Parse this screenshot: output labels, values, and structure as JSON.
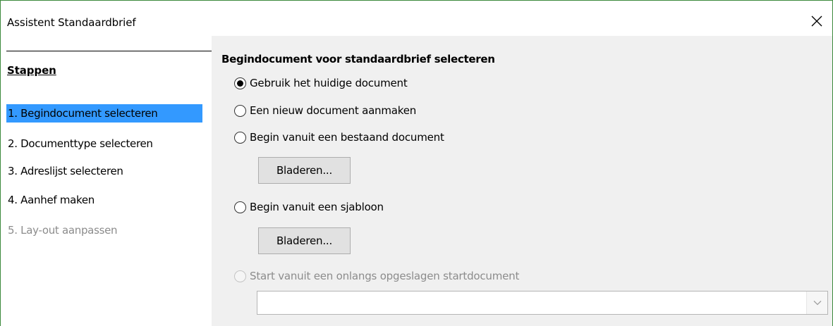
{
  "window": {
    "title": "Assistent Standaardbrief"
  },
  "sidebar": {
    "heading": "Stappen",
    "steps": [
      {
        "label": "1. Begindocument selecteren",
        "state": "active"
      },
      {
        "label": "2. Documenttype selecteren",
        "state": "enabled"
      },
      {
        "label": "3. Adreslijst selecteren",
        "state": "enabled"
      },
      {
        "label": "4. Aanhef maken",
        "state": "enabled"
      },
      {
        "label": "5. Lay-out aanpassen",
        "state": "disabled"
      }
    ]
  },
  "main": {
    "title": "Begindocument voor standaardbrief selecteren",
    "options": {
      "current": {
        "label": "Gebruik het huidige document",
        "checked": true
      },
      "new": {
        "label": "Een nieuw document aanmaken",
        "checked": false
      },
      "existing": {
        "label": "Begin vanuit een bestaand document",
        "checked": false
      },
      "template": {
        "label": "Begin vanuit een sjabloon",
        "checked": false
      },
      "recent": {
        "label": "Start vanuit een onlangs opgeslagen startdocument",
        "checked": false,
        "disabled": true
      }
    },
    "browse_existing_label": "Bladeren...",
    "browse_template_label": "Bladeren...",
    "recent_select_value": ""
  },
  "colors": {
    "window_border": "#3c8a3c",
    "selection": "#3399ff",
    "panel_bg": "#f0f0f0",
    "disabled_text": "#8c8c8c"
  },
  "icons": {
    "close": "close-icon",
    "combo_arrow": "chevron-down-icon"
  }
}
